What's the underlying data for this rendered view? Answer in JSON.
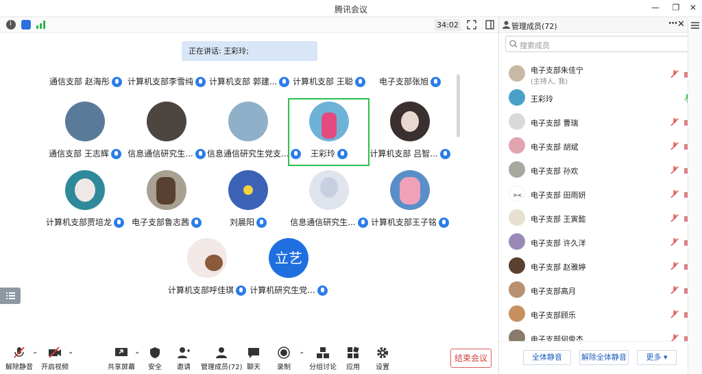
{
  "window": {
    "title": "腾讯会议"
  },
  "toolbar": {
    "timer": "34:02"
  },
  "stage": {
    "speaking": "正在讲话: 王彩玲;",
    "top_row": [
      {
        "name": "通信支部 赵海彤"
      },
      {
        "name": "计算机支部李雪纯"
      },
      {
        "name": "计算机支部 郭建..."
      },
      {
        "name": "计算机支部 王聪"
      },
      {
        "name": "电子支部张旭"
      }
    ],
    "row1": [
      {
        "name": "通信支部 王志辉",
        "color": "#5a7a9a"
      },
      {
        "name": "信息通信研究生...",
        "color": "#4d4540"
      },
      {
        "name": "信息通信研究生党支...",
        "color": "#8fb0c8"
      },
      {
        "name": "王彩玲",
        "color": "#6fb2d8"
      },
      {
        "name": "计算机支部 吕智...",
        "color": "#3a3030"
      }
    ],
    "row2": [
      {
        "name": "计算机支部贾培龙",
        "color": "#2e8a9a"
      },
      {
        "name": "电子支部鲁志茜",
        "color": "#a8a090"
      },
      {
        "name": "刘晨阳",
        "color": "#3c62b8"
      },
      {
        "name": "信息通信研究生...",
        "color": "#dfe4ee"
      },
      {
        "name": "计算机支部王子铭",
        "color": "#5a8ec8"
      }
    ],
    "row3": [
      {
        "name": "计算机支部呼佳琪",
        "color": "#f2e8e6"
      },
      {
        "name": "计算机研究生党...",
        "color": "#1f6fe0",
        "initials": "立艺"
      }
    ]
  },
  "bottom": {
    "mute": "解除静音",
    "video": "开启视频",
    "share": "共享屏幕",
    "security": "安全",
    "invite": "邀请",
    "members": "管理成员(72)",
    "chat": "聊天",
    "record": "录制",
    "breakout": "分组讨论",
    "apps": "应用",
    "settings": "设置",
    "end": "结束会议"
  },
  "panel": {
    "title": "管理成员(72)",
    "search_placeholder": "搜索成员",
    "members": [
      {
        "name": "电子支部朱佳宁",
        "sub": "(主持人, 我)",
        "color": "#c9b8a6"
      },
      {
        "name": "王彩玲",
        "sub": "",
        "color": "#4aa0c8"
      },
      {
        "name": "电子支部 曹瑞",
        "sub": "",
        "color": "#d9d9d9"
      },
      {
        "name": "电子支部 胡斌",
        "sub": "",
        "color": "#e2a5b0"
      },
      {
        "name": "电子支部 孙欢",
        "sub": "",
        "color": "#a8a8a0"
      },
      {
        "name": "电子支部 田雨妍",
        "sub": "",
        "color": "#ffffff"
      },
      {
        "name": "电子支部 王寅懿",
        "sub": "",
        "color": "#e8e0d0"
      },
      {
        "name": "电子支部 许久洋",
        "sub": "",
        "color": "#9a8ab8"
      },
      {
        "name": "电子支部 赵雅婷",
        "sub": "",
        "color": "#5a4030"
      },
      {
        "name": "电子支部高月",
        "sub": "",
        "color": "#b89070"
      },
      {
        "name": "电子支部顾乐",
        "sub": "",
        "color": "#c89060"
      },
      {
        "name": "电子支部何俊杰",
        "sub": "",
        "color": "#8a7a6a"
      }
    ],
    "mute_all": "全体静音",
    "unmute_all": "解除全体静音",
    "more": "更多 ▾"
  }
}
